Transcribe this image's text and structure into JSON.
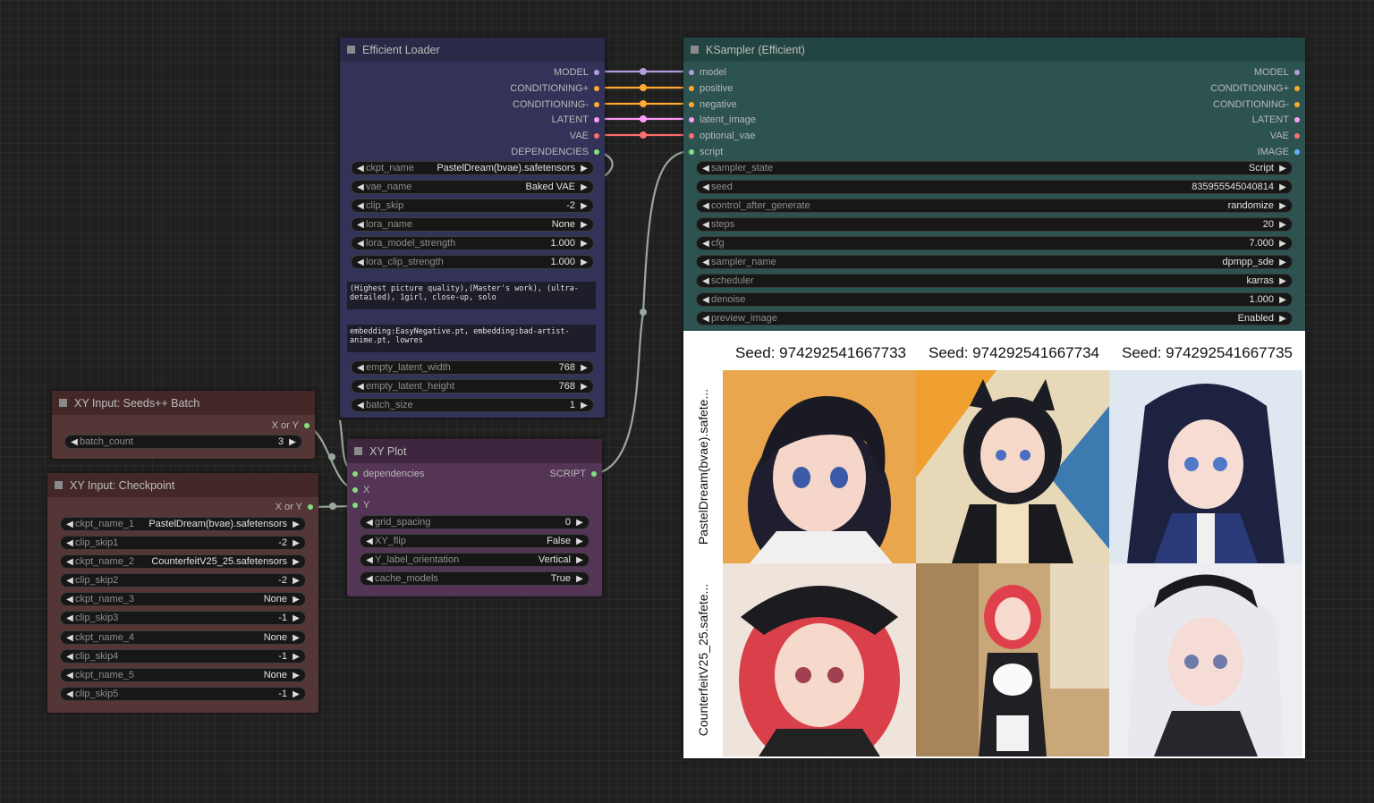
{
  "colors": {
    "model": "#b39ddb",
    "conditioning": "#ffa931",
    "latent": "#ff9cf9",
    "vae": "#ff6e6e",
    "dependencies": "#7fe27f",
    "image": "#64b5f6"
  },
  "efficient_loader": {
    "title": "Efficient Loader",
    "outputs": [
      "MODEL",
      "CONDITIONING+",
      "CONDITIONING-",
      "LATENT",
      "VAE",
      "DEPENDENCIES"
    ],
    "widgets": [
      {
        "label": "ckpt_name",
        "value": "PastelDream(bvae).safetensors"
      },
      {
        "label": "vae_name",
        "value": "Baked VAE"
      },
      {
        "label": "clip_skip",
        "value": "-2"
      },
      {
        "label": "lora_name",
        "value": "None"
      },
      {
        "label": "lora_model_strength",
        "value": "1.000"
      },
      {
        "label": "lora_clip_strength",
        "value": "1.000"
      }
    ],
    "positive_prompt": "(Highest picture quality),(Master's work), (ultra-detailed), 1girl, close-up, solo",
    "negative_prompt": "embedding:EasyNegative.pt, embedding:bad-artist-anime.pt, lowres",
    "widgets2": [
      {
        "label": "empty_latent_width",
        "value": "768"
      },
      {
        "label": "empty_latent_height",
        "value": "768"
      },
      {
        "label": "batch_size",
        "value": "1"
      }
    ]
  },
  "ksampler": {
    "title": "KSampler (Efficient)",
    "inputs": [
      "model",
      "positive",
      "negative",
      "latent_image",
      "optional_vae",
      "script"
    ],
    "outputs": [
      "MODEL",
      "CONDITIONING+",
      "CONDITIONING-",
      "LATENT",
      "VAE",
      "IMAGE"
    ],
    "widgets": [
      {
        "label": "sampler_state",
        "value": "Script"
      },
      {
        "label": "seed",
        "value": "835955545040814"
      },
      {
        "label": "control_after_generate",
        "value": "randomize"
      },
      {
        "label": "steps",
        "value": "20"
      },
      {
        "label": "cfg",
        "value": "7.000"
      },
      {
        "label": "sampler_name",
        "value": "dpmpp_sde"
      },
      {
        "label": "scheduler",
        "value": "karras"
      },
      {
        "label": "denoise",
        "value": "1.000"
      },
      {
        "label": "preview_image",
        "value": "Enabled"
      }
    ],
    "preview": {
      "column_labels": [
        "Seed: 974292541667733",
        "Seed: 974292541667734",
        "Seed: 974292541667735"
      ],
      "row_labels": [
        "PastelDream(bvae).safete...",
        "CounterfeitV25_25.safete..."
      ]
    }
  },
  "xy_seeds": {
    "title": "XY Input: Seeds++ Batch",
    "output": "X or Y",
    "widgets": [
      {
        "label": "batch_count",
        "value": "3"
      }
    ]
  },
  "xy_checkpoint": {
    "title": "XY Input: Checkpoint",
    "output": "X or Y",
    "widgets": [
      {
        "label": "ckpt_name_1",
        "value": "PastelDream(bvae).safetensors"
      },
      {
        "label": "clip_skip1",
        "value": "-2"
      },
      {
        "label": "ckpt_name_2",
        "value": "CounterfeitV25_25.safetensors"
      },
      {
        "label": "clip_skip2",
        "value": "-2"
      },
      {
        "label": "ckpt_name_3",
        "value": "None"
      },
      {
        "label": "clip_skip3",
        "value": "-1"
      },
      {
        "label": "ckpt_name_4",
        "value": "None"
      },
      {
        "label": "clip_skip4",
        "value": "-1"
      },
      {
        "label": "ckpt_name_5",
        "value": "None"
      },
      {
        "label": "clip_skip5",
        "value": "-1"
      }
    ]
  },
  "xy_plot": {
    "title": "XY Plot",
    "inputs": [
      "dependencies",
      "X",
      "Y"
    ],
    "output": "SCRIPT",
    "widgets": [
      {
        "label": "grid_spacing",
        "value": "0"
      },
      {
        "label": "XY_flip",
        "value": "False"
      },
      {
        "label": "Y_label_orientation",
        "value": "Vertical"
      },
      {
        "label": "cache_models",
        "value": "True"
      }
    ]
  }
}
